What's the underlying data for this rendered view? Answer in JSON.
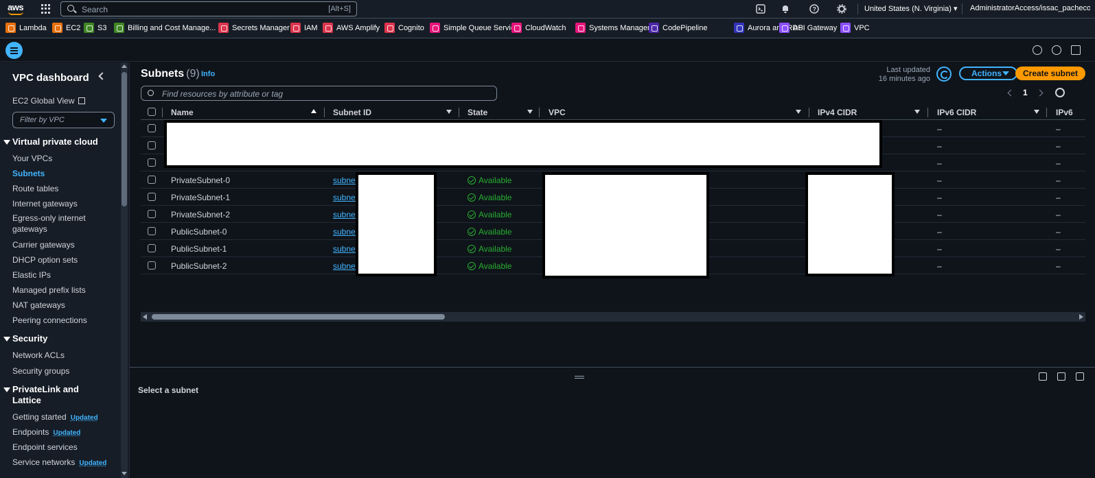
{
  "topbar": {
    "logo": "aws",
    "search_placeholder": "Search",
    "search_shortcut": "[Alt+S]",
    "region": "United States (N. Virginia) ▾",
    "account": "AdministratorAccess/issac_pacheco",
    "icons": [
      "cloudshell-icon",
      "bell-icon",
      "help-icon",
      "gear-icon"
    ]
  },
  "favorites": [
    {
      "label": "Lambda",
      "color": "#e7700d"
    },
    {
      "label": "EC2",
      "color": "#e7700d"
    },
    {
      "label": "S3",
      "color": "#3f8624"
    },
    {
      "label": "Billing and Cost Manage...",
      "color": "#3f8624"
    },
    {
      "label": "Secrets Manager",
      "color": "#dd344c"
    },
    {
      "label": "IAM",
      "color": "#dd344c"
    },
    {
      "label": "AWS Amplify",
      "color": "#dd344c"
    },
    {
      "label": "Cognito",
      "color": "#dd344c"
    },
    {
      "label": "Simple Queue Service",
      "color": "#e7157b"
    },
    {
      "label": "CloudWatch",
      "color": "#e7157b"
    },
    {
      "label": "Systems Manager",
      "color": "#e7157b"
    },
    {
      "label": "CodePipeline",
      "color": "#4d27aa"
    },
    {
      "label": "Aurora and RDS",
      "color": "#3334b9"
    },
    {
      "label": "API Gateway",
      "color": "#8c4fff"
    },
    {
      "label": "VPC",
      "color": "#8c4fff"
    }
  ],
  "sidebar": {
    "title": "VPC dashboard",
    "ec2_global_view": "EC2 Global View",
    "filter_placeholder": "Filter by VPC",
    "sections": {
      "vpc": "Virtual private cloud",
      "security": "Security",
      "privatelink": "PrivateLink and Lattice"
    },
    "vpc_items": [
      "Your VPCs",
      "Subnets",
      "Route tables",
      "Internet gateways",
      "Egress-only internet gateways",
      "Carrier gateways",
      "DHCP option sets",
      "Elastic IPs",
      "Managed prefix lists",
      "NAT gateways",
      "Peering connections"
    ],
    "security_items": [
      "Network ACLs",
      "Security groups"
    ],
    "privatelink_items": [
      {
        "label": "Getting started",
        "badge": "Updated"
      },
      {
        "label": "Endpoints",
        "badge": "Updated"
      },
      {
        "label": "Endpoint services",
        "badge": ""
      },
      {
        "label": "Service networks",
        "badge": "Updated"
      }
    ]
  },
  "main": {
    "title": "Subnets",
    "count": "(9)",
    "info": "Info",
    "last_updated_line1": "Last updated",
    "last_updated_line2": "16 minutes ago",
    "actions": "Actions",
    "create": "Create subnet",
    "find_placeholder": "Find resources by attribute or tag",
    "page": "1",
    "columns": [
      "Name",
      "Subnet ID",
      "State",
      "VPC",
      "IPv4 CIDR",
      "IPv6 CIDR",
      "IPv6"
    ],
    "rows": [
      {
        "name": "",
        "subnet_id": "",
        "state": "",
        "ipv6": "–",
        "ipv6b": "–"
      },
      {
        "name": "",
        "subnet_id": "",
        "state": "",
        "ipv6": "–",
        "ipv6b": "–"
      },
      {
        "name": "",
        "subnet_id": "",
        "state": "",
        "ipv6": "–",
        "ipv6b": "–"
      },
      {
        "name": "PrivateSubnet-0",
        "subnet_id": "subnet-",
        "state": "Available",
        "ipv6": "–",
        "ipv6b": "–"
      },
      {
        "name": "PrivateSubnet-1",
        "subnet_id": "subnet-",
        "state": "Available",
        "ipv6": "–",
        "ipv6b": "–"
      },
      {
        "name": "PrivateSubnet-2",
        "subnet_id": "subnet-",
        "state": "Available",
        "ipv6": "–",
        "ipv6b": "–"
      },
      {
        "name": "PublicSubnet-0",
        "subnet_id": "subnet-",
        "state": "Available",
        "ipv6": "–",
        "ipv6b": "–"
      },
      {
        "name": "PublicSubnet-1",
        "subnet_id": "subnet-",
        "state": "Available",
        "ipv6": "–",
        "ipv6b": "–"
      },
      {
        "name": "PublicSubnet-2",
        "subnet_id": "subnet-",
        "state": "Available",
        "ipv6": "–",
        "ipv6b": "–"
      }
    ]
  },
  "split_panel": {
    "message": "Select a subnet"
  }
}
